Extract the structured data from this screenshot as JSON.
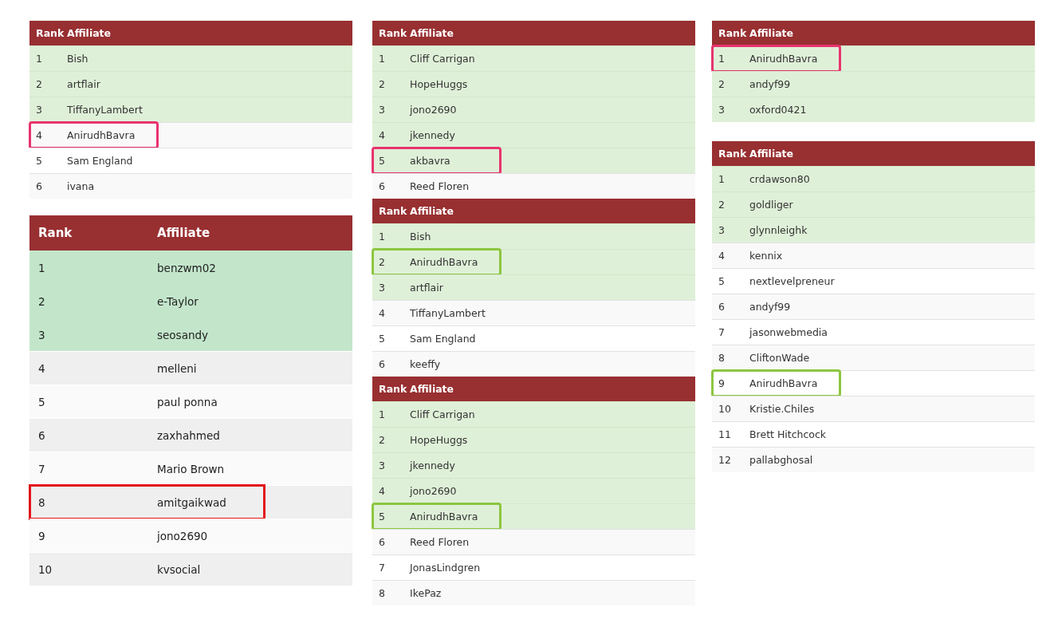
{
  "columns": [
    {
      "tables": [
        {
          "kind": "compact",
          "headers": [
            "Rank",
            "Affiliate"
          ],
          "rows": [
            {
              "rank": "1",
              "name": "Bish",
              "highlighted": true
            },
            {
              "rank": "2",
              "name": "artflair",
              "highlighted": true
            },
            {
              "rank": "3",
              "name": "TiffanyLambert",
              "highlighted": true
            },
            {
              "rank": "4",
              "name": "AnirudhBavra",
              "highlighted": false,
              "color": "#e8336e"
            },
            {
              "rank": "5",
              "name": "Sam England",
              "highlighted": false
            },
            {
              "rank": "6",
              "name": "ivana",
              "highlighted": false
            }
          ]
        },
        {
          "kind": "large",
          "headers": [
            "Rank",
            "Affiliate"
          ],
          "rows": [
            {
              "rank": "1",
              "name": "benzwm02",
              "highlighted": true
            },
            {
              "rank": "2",
              "name": "e-Taylor",
              "highlighted": true
            },
            {
              "rank": "3",
              "name": "seosandy",
              "highlighted": true
            },
            {
              "rank": "4",
              "name": "melleni",
              "highlighted": false
            },
            {
              "rank": "5",
              "name": "paul ponna",
              "highlighted": false
            },
            {
              "rank": "6",
              "name": "zaxhahmed",
              "highlighted": false
            },
            {
              "rank": "7",
              "name": "Mario Brown",
              "highlighted": false
            },
            {
              "rank": "8",
              "name": "amitgaikwad",
              "highlighted": false,
              "color": "#e3141b"
            },
            {
              "rank": "9",
              "name": "jono2690",
              "highlighted": false
            },
            {
              "rank": "10",
              "name": "kvsocial",
              "highlighted": false
            }
          ]
        }
      ]
    },
    {
      "tables": [
        {
          "kind": "compact",
          "headers": [
            "Rank",
            "Affiliate"
          ],
          "rows": [
            {
              "rank": "1",
              "name": "Cliff Carrigan",
              "highlighted": true
            },
            {
              "rank": "2",
              "name": "HopeHuggs",
              "highlighted": true
            },
            {
              "rank": "3",
              "name": "jono2690",
              "highlighted": true
            },
            {
              "rank": "4",
              "name": "jkennedy",
              "highlighted": true
            },
            {
              "rank": "5",
              "name": "akbavra",
              "highlighted": true,
              "color": "#e8336e"
            },
            {
              "rank": "6",
              "name": "Reed Floren",
              "highlighted": false
            }
          ]
        },
        {
          "kind": "compact",
          "headers": [
            "Rank",
            "Affiliate"
          ],
          "rows": [
            {
              "rank": "1",
              "name": "Bish",
              "highlighted": true
            },
            {
              "rank": "2",
              "name": "AnirudhBavra",
              "highlighted": true,
              "color": "#8cc63f"
            },
            {
              "rank": "3",
              "name": "artflair",
              "highlighted": true
            },
            {
              "rank": "4",
              "name": "TiffanyLambert",
              "highlighted": false
            },
            {
              "rank": "5",
              "name": "Sam England",
              "highlighted": false
            },
            {
              "rank": "6",
              "name": "keeffy",
              "highlighted": false
            }
          ]
        },
        {
          "kind": "compact",
          "headers": [
            "Rank",
            "Affiliate"
          ],
          "rows": [
            {
              "rank": "1",
              "name": "Cliff Carrigan",
              "highlighted": true
            },
            {
              "rank": "2",
              "name": "HopeHuggs",
              "highlighted": true
            },
            {
              "rank": "3",
              "name": "jkennedy",
              "highlighted": true
            },
            {
              "rank": "4",
              "name": "jono2690",
              "highlighted": true
            },
            {
              "rank": "5",
              "name": "AnirudhBavra",
              "highlighted": true,
              "color": "#8cc63f"
            },
            {
              "rank": "6",
              "name": "Reed Floren",
              "highlighted": false
            },
            {
              "rank": "7",
              "name": "JonasLindgren",
              "highlighted": false
            },
            {
              "rank": "8",
              "name": "IkePaz",
              "highlighted": false
            }
          ]
        }
      ]
    },
    {
      "tables": [
        {
          "kind": "compact",
          "headers": [
            "Rank",
            "Affiliate"
          ],
          "rows": [
            {
              "rank": "1",
              "name": "AnirudhBavra",
              "highlighted": true,
              "color": "#e8336e"
            },
            {
              "rank": "2",
              "name": "andyf99",
              "highlighted": true
            },
            {
              "rank": "3",
              "name": "oxford0421",
              "highlighted": true
            }
          ]
        },
        {
          "kind": "compact",
          "headers": [
            "Rank",
            "Affiliate"
          ],
          "rows": [
            {
              "rank": "1",
              "name": "crdawson80",
              "highlighted": true
            },
            {
              "rank": "2",
              "name": "goldliger",
              "highlighted": true
            },
            {
              "rank": "3",
              "name": "glynnleighk",
              "highlighted": true
            },
            {
              "rank": "4",
              "name": "kennix",
              "highlighted": false
            },
            {
              "rank": "5",
              "name": "nextlevelpreneur",
              "highlighted": false
            },
            {
              "rank": "6",
              "name": "andyf99",
              "highlighted": false
            },
            {
              "rank": "7",
              "name": "jasonwebmedia",
              "highlighted": false
            },
            {
              "rank": "8",
              "name": "CliftonWade",
              "highlighted": false
            },
            {
              "rank": "9",
              "name": "AnirudhBavra",
              "highlighted": false,
              "color": "#8cc63f"
            },
            {
              "rank": "10",
              "name": "Kristie.Chiles",
              "highlighted": false
            },
            {
              "rank": "11",
              "name": "Brett Hitchcock",
              "highlighted": false
            },
            {
              "rank": "12",
              "name": "pallabghosal",
              "highlighted": false
            }
          ]
        }
      ]
    }
  ]
}
